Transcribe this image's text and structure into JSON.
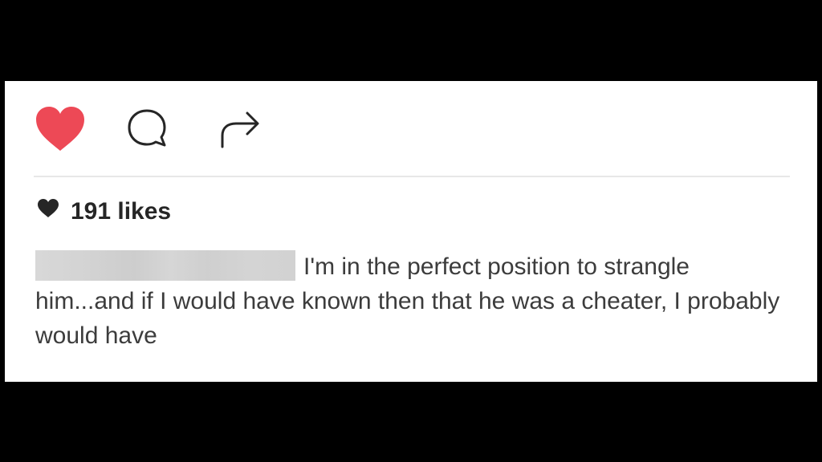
{
  "post": {
    "actions": {
      "like_icon": "heart-filled-icon",
      "comment_icon": "comment-bubble-icon",
      "share_icon": "share-arrow-icon",
      "like_color": "#ed4956"
    },
    "likes": {
      "icon": "heart-small-icon",
      "text": "191 likes"
    },
    "caption": {
      "username_redacted": true,
      "text": "I'm in the perfect position to strangle him...and if I would have known then that he was a cheater, I probably would have"
    }
  }
}
